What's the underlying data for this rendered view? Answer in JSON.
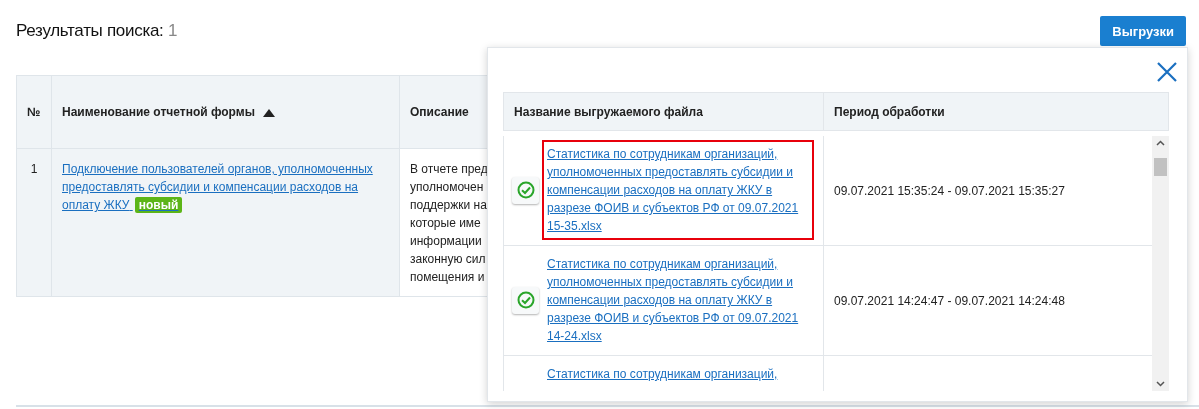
{
  "title": {
    "label": "Результаты поиска:",
    "count": "1"
  },
  "export_button": {
    "label": "Выгрузки"
  },
  "table": {
    "columns": [
      {
        "label": "№",
        "sorted": false
      },
      {
        "label": "Наименование отчетной формы",
        "sorted": true
      },
      {
        "label": "Описание",
        "sorted": false
      }
    ],
    "rows": [
      {
        "number": "1",
        "name": "Подключение пользователей органов, уполномоченных предоставлять субсидии и компенсации расходов на оплату ЖКУ",
        "badge": "новый",
        "description": [
          "В отчете пред",
          "уполномочен",
          "поддержки на",
          "которые име",
          "информации",
          "законную сил",
          "помещения и"
        ]
      }
    ]
  },
  "popup": {
    "columns": [
      "Название выгружаемого файла",
      "Период обработки"
    ],
    "rows": [
      {
        "file": "Статистика по сотрудникам организаций, уполномоченных предоставлять субсидии и компенсации расходов на оплату ЖКУ в разрезе ФОИВ и субъектов РФ от 09.07.2021 15-35.xlsx",
        "period": "09.07.2021 15:35:24 - 09.07.2021 15:35:27",
        "done": true,
        "highlighted": true
      },
      {
        "file": "Статистика по сотрудникам организаций, уполномоченных предоставлять субсидии и компенсации расходов на оплату ЖКУ в разрезе ФОИВ и субъектов РФ от 09.07.2021 14-24.xlsx",
        "period": "09.07.2021 14:24:47 - 09.07.2021 14:24:48",
        "done": true,
        "highlighted": false
      },
      {
        "file": "Статистика по сотрудникам организаций,",
        "done": false,
        "highlighted": false
      }
    ]
  }
}
